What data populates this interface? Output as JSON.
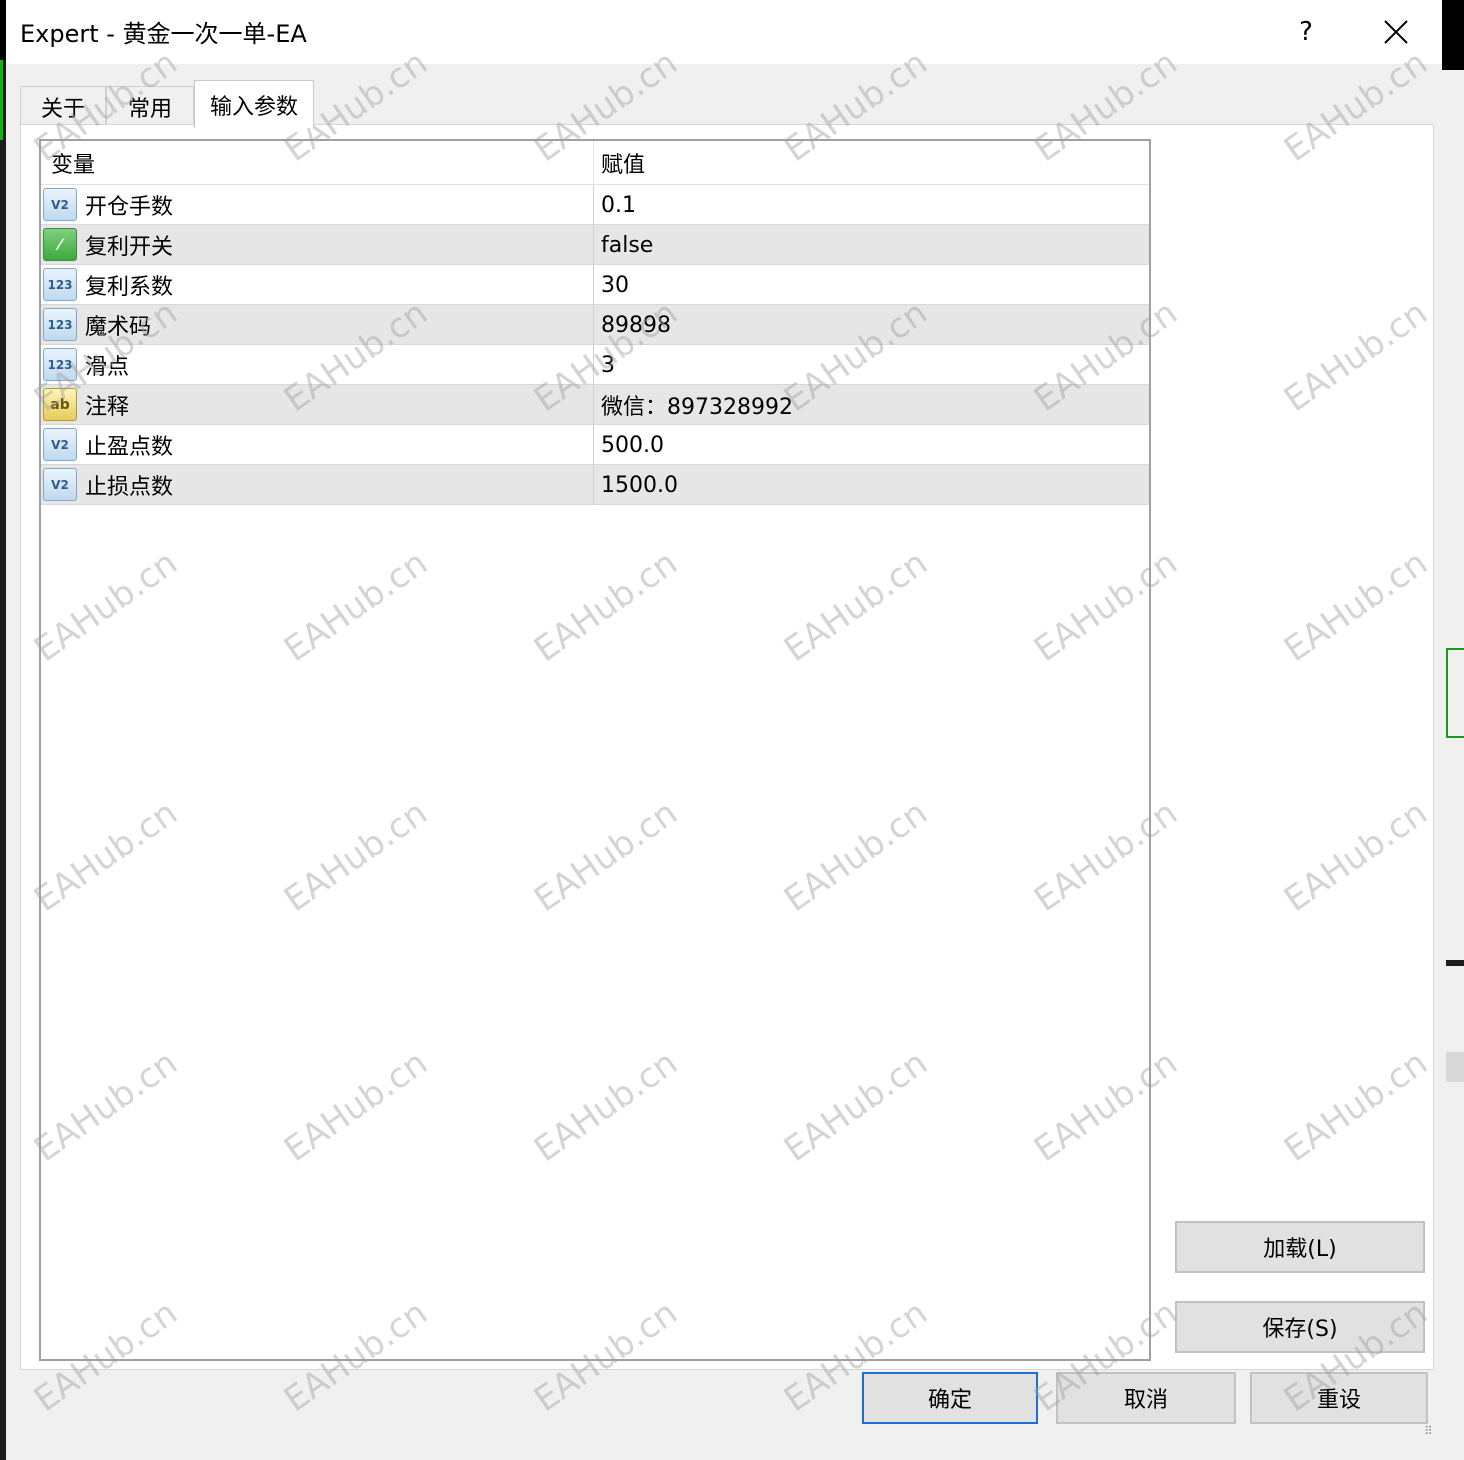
{
  "window": {
    "title": "Expert - 黄金一次一单-EA",
    "help_label": "?",
    "close_icon": "close-icon"
  },
  "tabs": [
    {
      "label": "关于",
      "active": false
    },
    {
      "label": "常用",
      "active": false
    },
    {
      "label": "输入参数",
      "active": true
    }
  ],
  "grid": {
    "columns": [
      "变量",
      "赋值"
    ],
    "rows": [
      {
        "icon": "double-icon",
        "icon_text": "V2",
        "name": "开仓手数",
        "value": "0.1"
      },
      {
        "icon": "bool-icon",
        "icon_text": "⁄",
        "name": "复利开关",
        "value": "false"
      },
      {
        "icon": "int-icon",
        "icon_text": "123",
        "name": "复利系数",
        "value": "30"
      },
      {
        "icon": "int-icon",
        "icon_text": "123",
        "name": "魔术码",
        "value": "89898"
      },
      {
        "icon": "int-icon",
        "icon_text": "123",
        "name": "滑点",
        "value": "3"
      },
      {
        "icon": "string-icon",
        "icon_text": "ab",
        "name": "注释",
        "value": "微信：897328992"
      },
      {
        "icon": "double-icon",
        "icon_text": "V2",
        "name": "止盈点数",
        "value": "500.0"
      },
      {
        "icon": "double-icon",
        "icon_text": "V2",
        "name": "止损点数",
        "value": "1500.0"
      }
    ]
  },
  "side_buttons": {
    "load": "加载(L)",
    "save": "保存(S)"
  },
  "footer_buttons": {
    "ok": "确定",
    "cancel": "取消",
    "reset": "重设"
  },
  "watermark": "EAHub.cn"
}
